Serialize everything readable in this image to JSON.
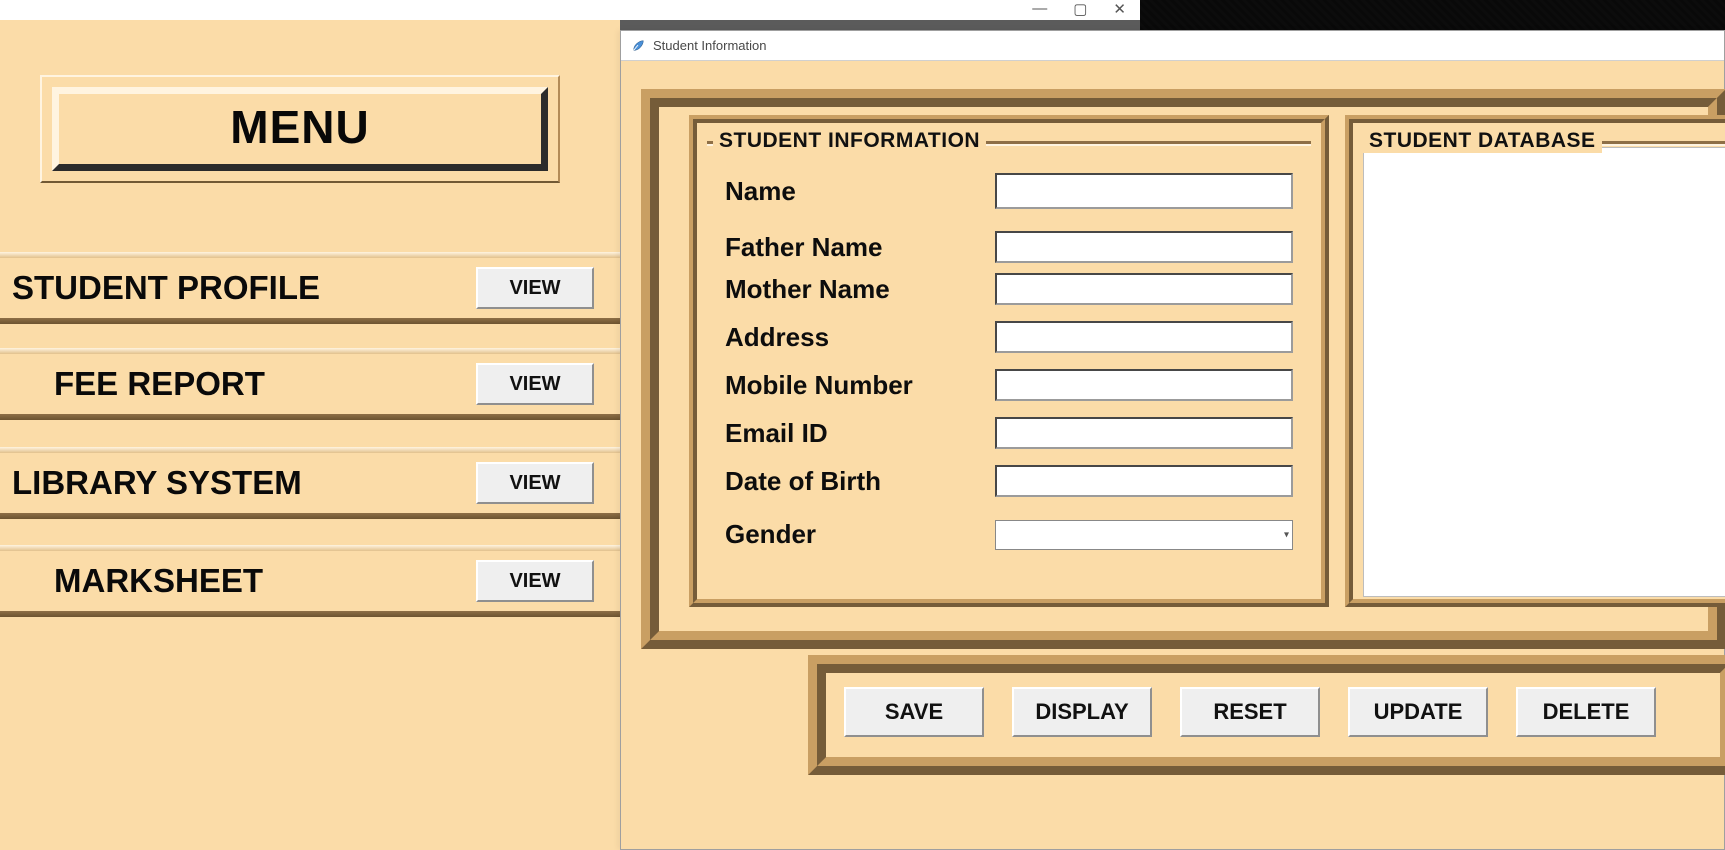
{
  "chrome": {
    "min_glyph": "—",
    "max_glyph": "▢",
    "close_glyph": "✕"
  },
  "menu": {
    "title": "MENU",
    "items": [
      {
        "label": "STUDENT PROFILE",
        "button": "VIEW"
      },
      {
        "label": "FEE REPORT",
        "button": "VIEW"
      },
      {
        "label": "LIBRARY SYSTEM",
        "button": "VIEW"
      },
      {
        "label": "MARKSHEET",
        "button": "VIEW"
      }
    ]
  },
  "info_window": {
    "title": "Student Information",
    "form_legend": "STUDENT INFORMATION",
    "db_legend": "STUDENT DATABASE",
    "fields": {
      "name": {
        "label": "Name",
        "value": ""
      },
      "father": {
        "label": "Father Name",
        "value": ""
      },
      "mother": {
        "label": "Mother Name",
        "value": ""
      },
      "address": {
        "label": "Address",
        "value": ""
      },
      "mobile": {
        "label": "Mobile Number",
        "value": ""
      },
      "email": {
        "label": "Email ID",
        "value": ""
      },
      "dob": {
        "label": "Date of Birth",
        "value": ""
      },
      "gender": {
        "label": "Gender",
        "value": ""
      }
    },
    "actions": {
      "save": "SAVE",
      "display": "DISPLAY",
      "reset": "RESET",
      "update": "UPDATE",
      "delete": "DELETE"
    }
  },
  "colors": {
    "peach": "#fbdca8",
    "ridge_light": "#fff4e0",
    "ridge_dark": "#7a5f3a"
  }
}
